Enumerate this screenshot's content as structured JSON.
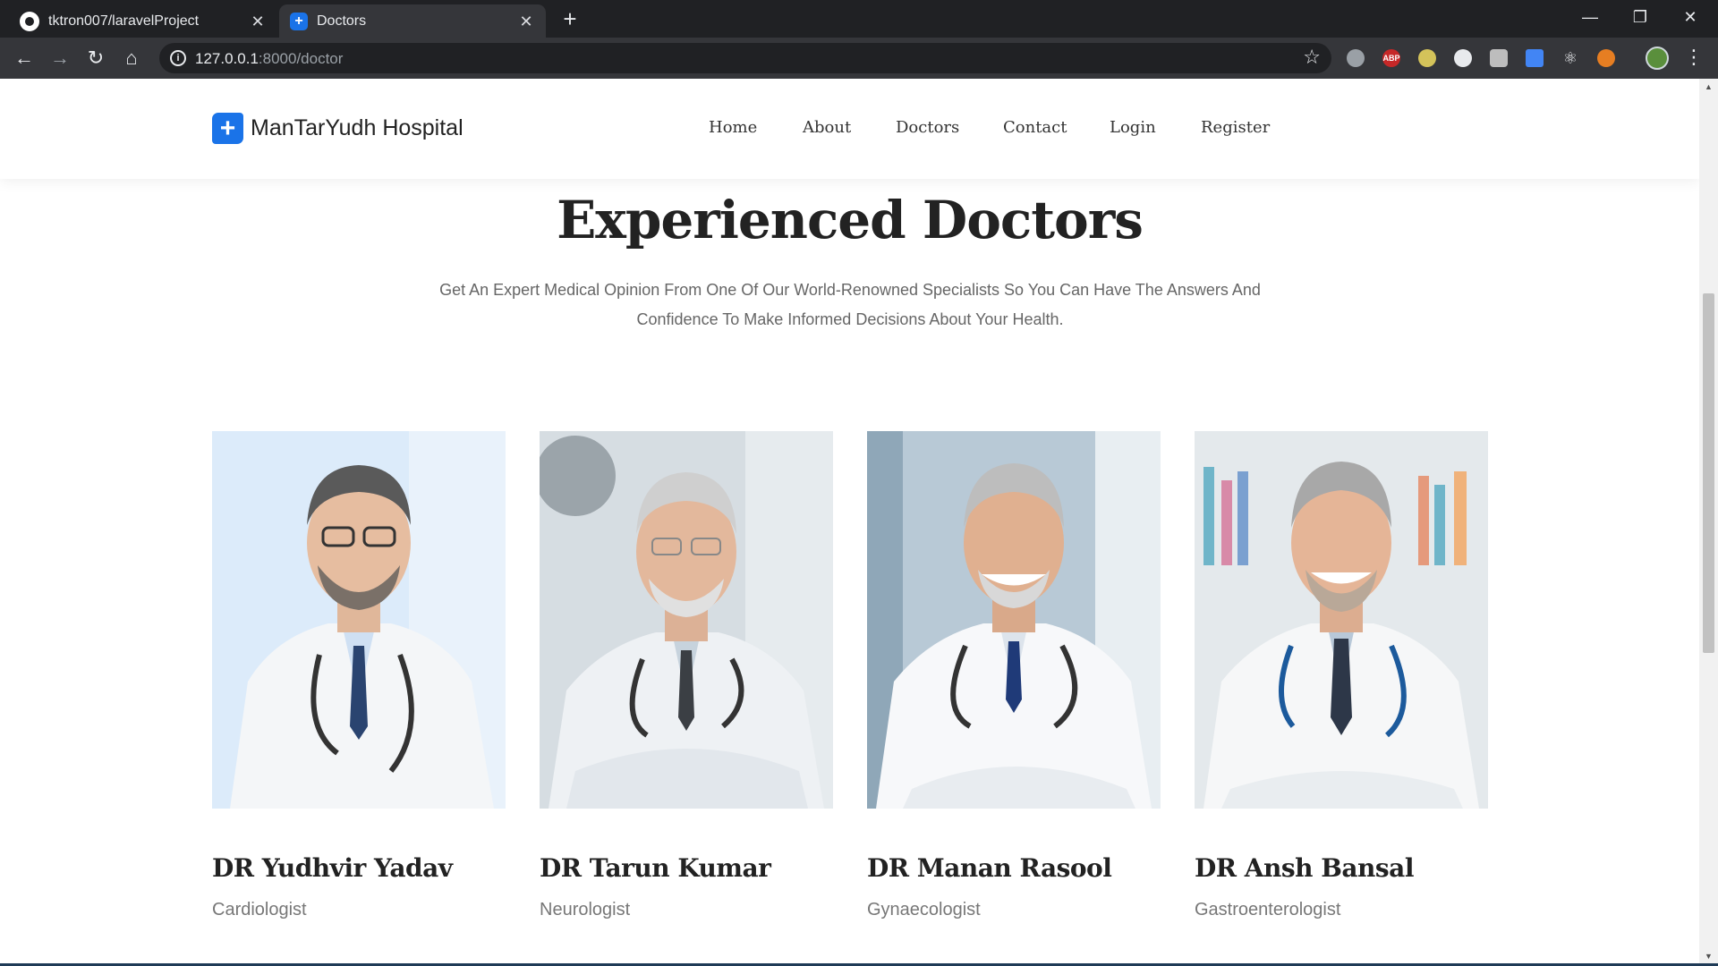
{
  "browser": {
    "tabs": [
      {
        "title": "tktron007/laravelProject",
        "icon": "github-icon",
        "active": false
      },
      {
        "title": "Doctors",
        "icon": "hospital-favicon-icon",
        "active": true
      }
    ],
    "url_host": "127.0.0.1",
    "url_path": ":8000/doctor",
    "extensions": [
      "edge-icon",
      "adblock-icon",
      "bulb-icon",
      "circle-block-icon",
      "camera-icon",
      "translate-icon",
      "react-icon",
      "color-icon"
    ],
    "adblock_label": "ABP"
  },
  "site": {
    "brand": "ManTarYudh Hospital",
    "brand_color": "#1a73e8",
    "nav": [
      "Home",
      "About",
      "Doctors",
      "Contact",
      "Login",
      "Register"
    ]
  },
  "hero": {
    "title": "Experienced Doctors",
    "subtitle_line1": "Get An Expert Medical Opinion From One Of Our World-Renowned Specialists So You Can Have The Answers And",
    "subtitle_line2": "Confidence To Make Informed Decisions About Your Health."
  },
  "doctors": [
    {
      "name": "DR Yudhvir Yadav",
      "specialty": "Cardiologist"
    },
    {
      "name": "DR Tarun Kumar",
      "specialty": "Neurologist"
    },
    {
      "name": "DR Manan Rasool",
      "specialty": "Gynaecologist"
    },
    {
      "name": "DR Ansh Bansal",
      "specialty": "Gastroenterologist"
    }
  ]
}
